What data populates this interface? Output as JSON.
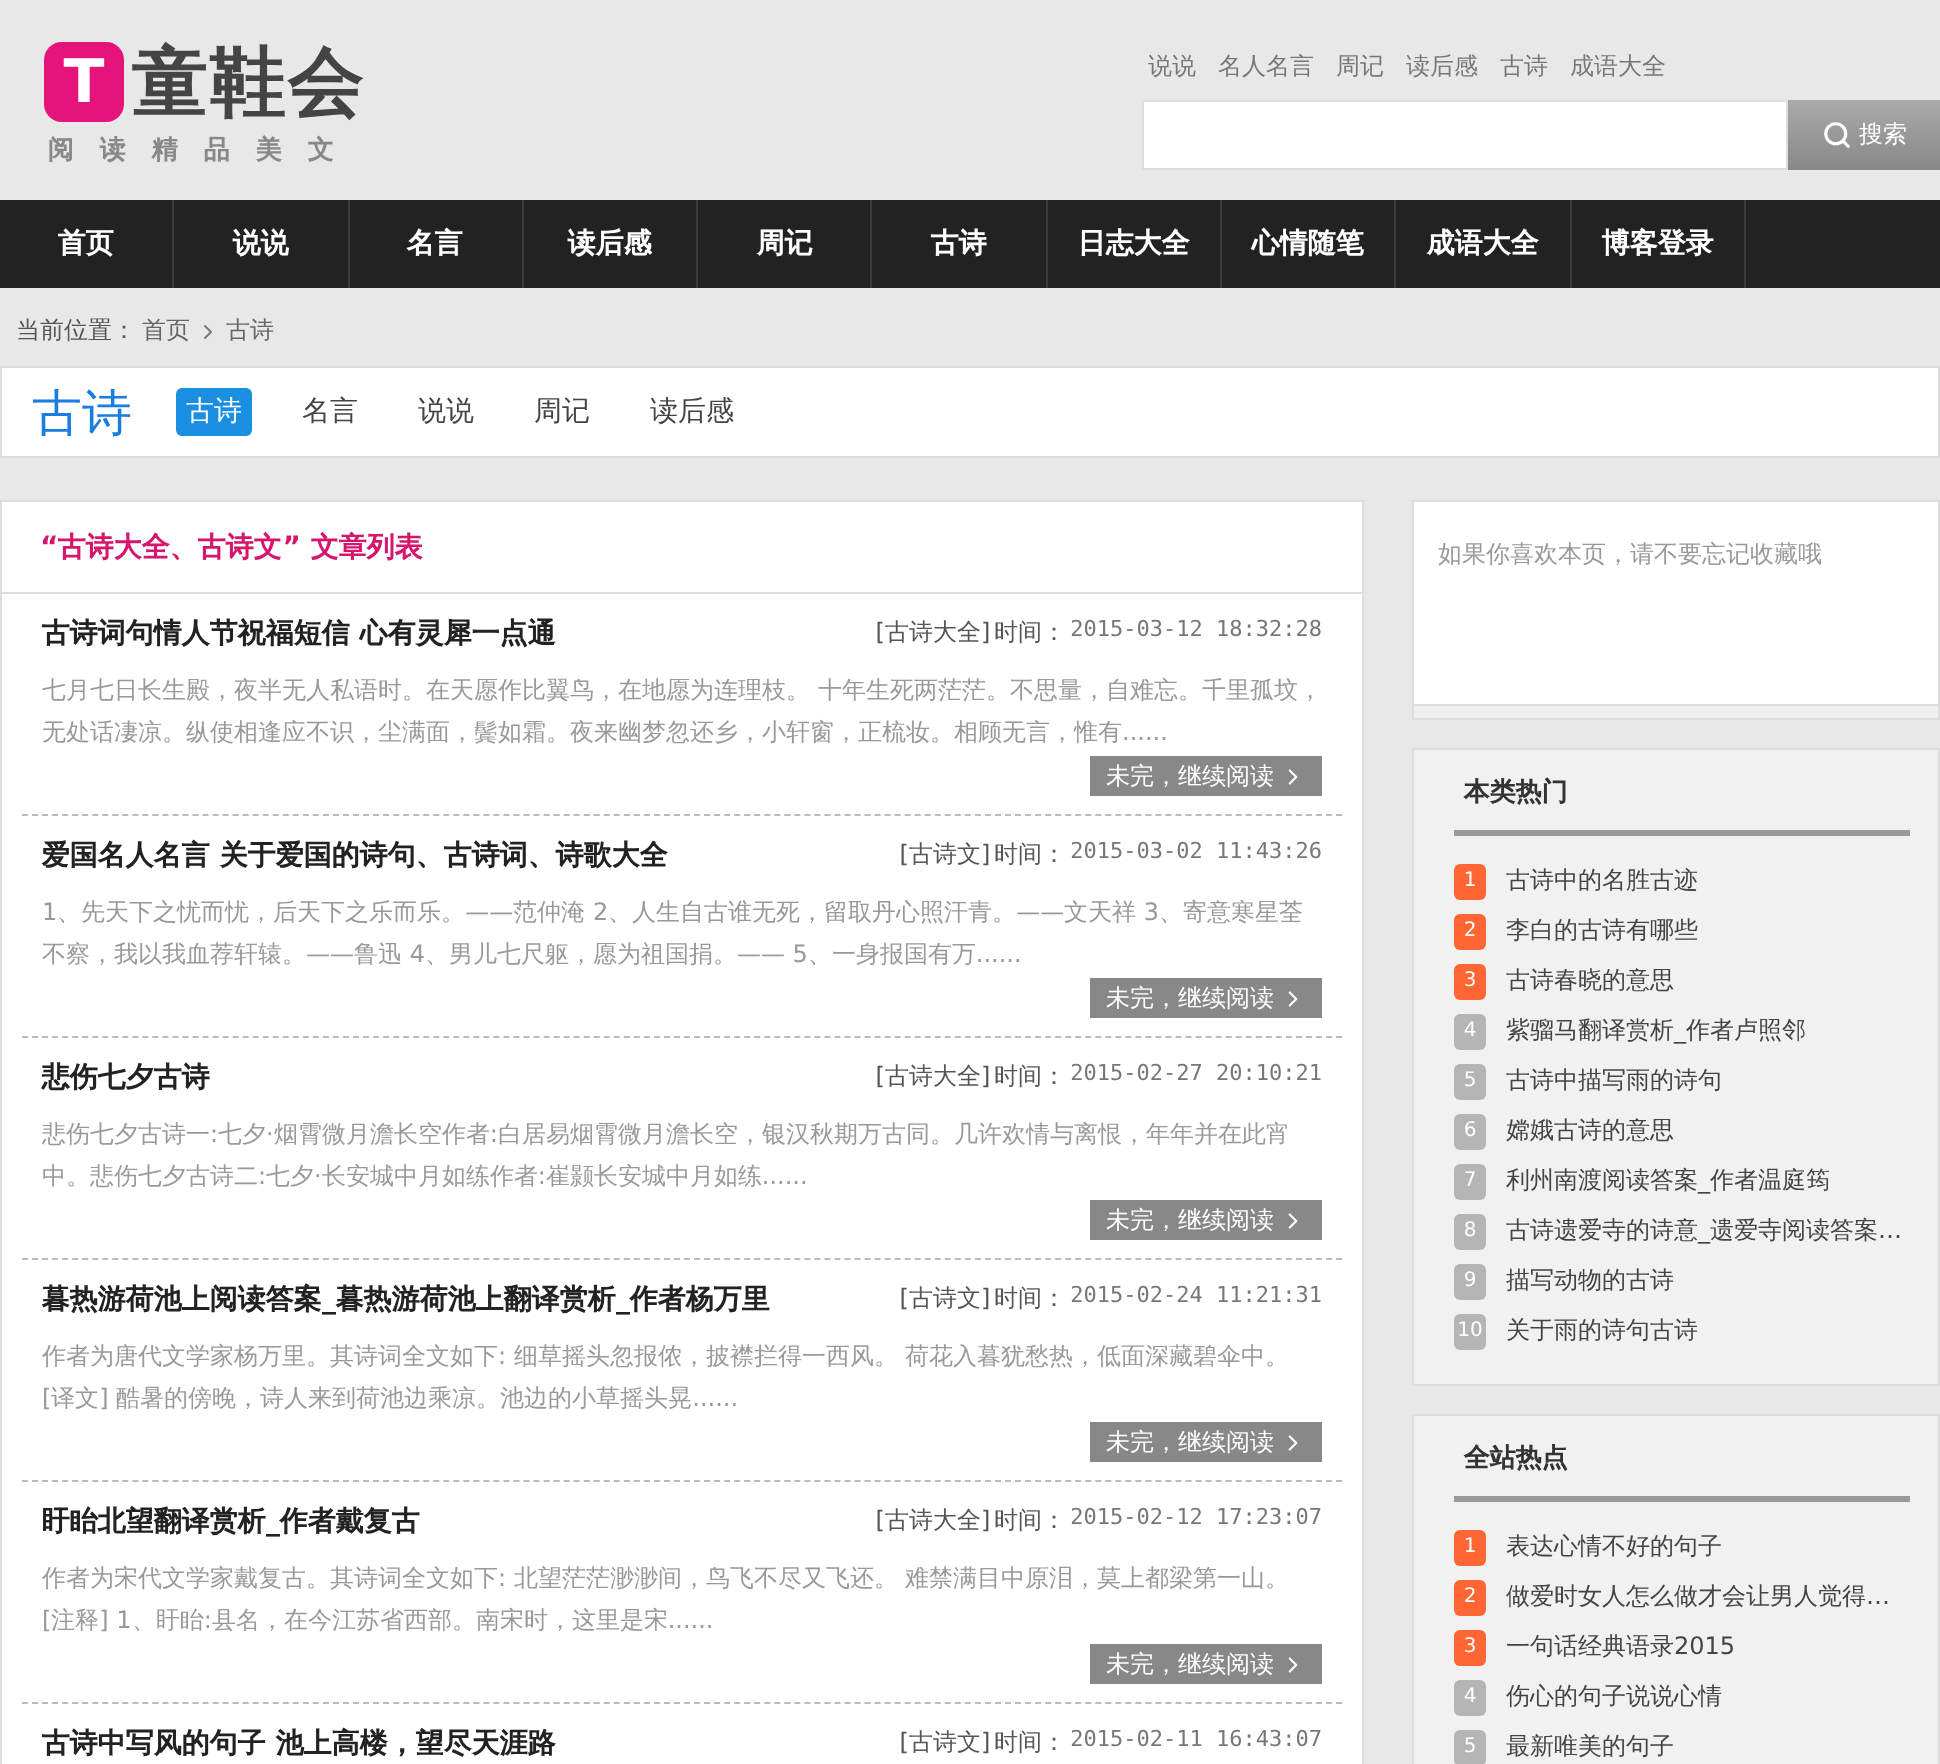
{
  "logo": {
    "mark": "T",
    "name": "童鞋会",
    "slogan": [
      "阅",
      "读",
      "精",
      "品",
      "美",
      "文"
    ]
  },
  "top_links": [
    "说说",
    "名人名言",
    "周记",
    "读后感",
    "古诗",
    "成语大全"
  ],
  "search": {
    "button": "搜索"
  },
  "nav": [
    "首页",
    "说说",
    "名言",
    "读后感",
    "周记",
    "古诗",
    "日志大全",
    "心情随笔",
    "成语大全",
    "博客登录"
  ],
  "breadcrumb": {
    "label": "当前位置：",
    "items": [
      "首页",
      "古诗"
    ]
  },
  "category": {
    "title": "古诗",
    "tabs": [
      {
        "label": "古诗",
        "selected": true
      },
      {
        "label": "名言",
        "selected": false
      },
      {
        "label": "说说",
        "selected": false
      },
      {
        "label": "周记",
        "selected": false
      },
      {
        "label": "读后感",
        "selected": false
      }
    ]
  },
  "article_list": {
    "heading": "“古诗大全、古诗文” 文章列表",
    "articles": [
      {
        "title": "古诗词句情人节祝福短信 心有灵犀一点通",
        "tag": "[古诗大全]",
        "time_label": "时间：",
        "time": "2015-03-12 18:32:28",
        "excerpt": "七月七日长生殿，夜半无人私语时。在天愿作比翼鸟，在地愿为连理枝。 十年生死两茫茫。不思量，自难忘。千里孤坟，无处话凄凉。纵使相逢应不识，尘满面，鬓如霜。夜来幽梦忽还乡，小轩窗，正梳妆。相顾无言，惟有......",
        "more": "未完，继续阅读"
      },
      {
        "title": "爱国名人名言 关于爱国的诗句、古诗词、诗歌大全",
        "tag": "[古诗文]",
        "time_label": "时间：",
        "time": "2015-03-02 11:43:26",
        "excerpt": "1、先天下之忧而忧，后天下之乐而乐。——范仲淹 2、人生自古谁无死，留取丹心照汗青。——文天祥 3、寄意寒星荃不察，我以我血荐轩辕。——鲁迅 4、男儿七尺躯，愿为祖国捐。—— 5、一身报国有万......",
        "more": "未完，继续阅读"
      },
      {
        "title": "悲伤七夕古诗",
        "tag": "[古诗大全]",
        "time_label": "时间：",
        "time": "2015-02-27 20:10:21",
        "excerpt": "悲伤七夕古诗一:七夕·烟霄微月澹长空作者:白居易烟霄微月澹长空，银汉秋期万古同。几许欢情与离恨，年年并在此宵中。悲伤七夕古诗二:七夕·长安城中月如练作者:崔颢长安城中月如练......",
        "more": "未完，继续阅读"
      },
      {
        "title": "暮热游荷池上阅读答案_暮热游荷池上翻译赏析_作者杨万里",
        "tag": "[古诗文]",
        "time_label": "时间：",
        "time": "2015-02-24 11:21:31",
        "excerpt": "作者为唐代文学家杨万里。其诗词全文如下: 细草摇头忽报侬，披襟拦得一西风。 荷花入暮犹愁热，低面深藏碧伞中。 [译文] 酷暑的傍晚，诗人来到荷池边乘凉。池边的小草摇头晃......",
        "more": "未完，继续阅读"
      },
      {
        "title": "盱眙北望翻译赏析_作者戴复古",
        "tag": "[古诗大全]",
        "time_label": "时间：",
        "time": "2015-02-12 17:23:07",
        "excerpt": "作者为宋代文学家戴复古。其诗词全文如下: 北望茫茫渺渺间，鸟飞不尽又飞还。 难禁满目中原泪，莫上都梁第一山。 [注释] 1、盱眙:县名，在今江苏省西部。南宋时，这里是宋......",
        "more": "未完，继续阅读"
      },
      {
        "title": "古诗中写风的句子 池上高楼，望尽天涯路",
        "tag": "[古诗文]",
        "time_label": "时间：",
        "time": "2015-02-11 16:43:07"
      }
    ]
  },
  "bookmark_note": "如果你喜欢本页，请不要忘记收藏哦",
  "hot_lists": [
    {
      "title": "本类热门",
      "items": [
        {
          "rank": "1",
          "text": "古诗中的名胜古迹",
          "color": "#ff6633"
        },
        {
          "rank": "2",
          "text": "李白的古诗有哪些",
          "color": "#ff6633"
        },
        {
          "rank": "3",
          "text": "古诗春晓的意思",
          "color": "#ff6633"
        },
        {
          "rank": "4",
          "text": "紫骝马翻译赏析_作者卢照邻",
          "color": "#b5b5b5"
        },
        {
          "rank": "5",
          "text": "古诗中描写雨的诗句",
          "color": "#b5b5b5"
        },
        {
          "rank": "6",
          "text": "嫦娥古诗的意思",
          "color": "#b5b5b5"
        },
        {
          "rank": "7",
          "text": "利州南渡阅读答案_作者温庭筠",
          "color": "#b5b5b5"
        },
        {
          "rank": "8",
          "text": "古诗遗爱寺的诗意_遗爱寺阅读答案…",
          "color": "#b5b5b5"
        },
        {
          "rank": "9",
          "text": "描写动物的古诗",
          "color": "#b5b5b5"
        },
        {
          "rank": "10",
          "text": "关于雨的诗句古诗",
          "color": "#b5b5b5"
        }
      ]
    },
    {
      "title": "全站热点",
      "items": [
        {
          "rank": "1",
          "text": "表达心情不好的句子",
          "color": "#ff6633"
        },
        {
          "rank": "2",
          "text": "做爱时女人怎么做才会让男人觉得…",
          "color": "#ff6633"
        },
        {
          "rank": "3",
          "text": "一句话经典语录2015",
          "color": "#ff6633"
        },
        {
          "rank": "4",
          "text": "伤心的句子说说心情",
          "color": "#b5b5b5"
        },
        {
          "rank": "5",
          "text": "最新唯美的句子",
          "color": "#b5b5b5"
        }
      ]
    }
  ]
}
